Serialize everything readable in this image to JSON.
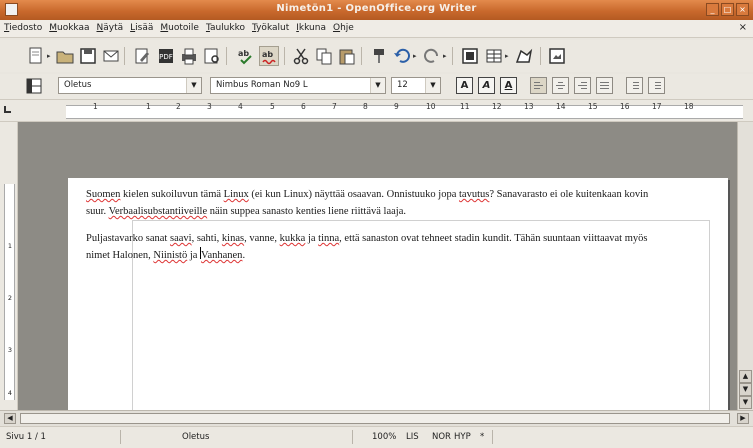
{
  "window": {
    "title": "Nimetön1 - OpenOffice.org Writer",
    "controls": [
      "_",
      "□",
      "×"
    ]
  },
  "menubar": {
    "items": [
      "Tiedosto",
      "Muokkaa",
      "Näytä",
      "Lisää",
      "Muotoile",
      "Taulukko",
      "Työkalut",
      "Ikkuna",
      "Ohje"
    ],
    "close_label": "×"
  },
  "toolbar_standard": {
    "icons": [
      "new-document-icon",
      "open-folder-icon",
      "save-icon",
      "email-icon",
      "edit-file-icon",
      "export-pdf-icon",
      "print-icon",
      "page-preview-icon",
      "spellcheck-icon",
      "auto-spellcheck-icon",
      "cut-icon",
      "copy-icon",
      "paste-icon",
      "format-paintbrush-icon",
      "undo-icon",
      "redo-icon",
      "navigator-icon",
      "table-icon",
      "draw-functions-icon",
      "gallery-icon"
    ]
  },
  "toolbar_formatting": {
    "paragraph_style": "Oletus",
    "font_name": "Nimbus Roman No9 L",
    "font_size": "12",
    "bold": "A",
    "italic": "A",
    "underline": "A"
  },
  "ruler": {
    "labels": [
      "1",
      "1",
      "2",
      "3",
      "4",
      "5",
      "6",
      "7",
      "8",
      "9",
      "10",
      "11",
      "12",
      "13",
      "14",
      "15",
      "16",
      "17",
      "18"
    ],
    "vertical_labels": [
      "1",
      "2",
      "3",
      "4"
    ]
  },
  "document": {
    "paragraph1": {
      "t1": "Suomen",
      "t2": " kielen sukoiluvun tämä ",
      "t3": "Linux",
      "t4": " (ei kun Linux) näyttää osaavan. Onnistuuko jopa ",
      "t5": "tavutus",
      "t6": "? Sanavarasto ei ole kuitenkaan kovin suur. ",
      "t7": "Verbaalisubstantiiveille",
      "t8": " näin suppea sanasto kenties liene riittävä laaja."
    },
    "paragraph2": {
      "t1": "Puljastavarko sanat ",
      "t2": "saavi",
      "t3": ", sahti, ",
      "t4": "kinas",
      "t5": ", vanne, ",
      "t6": "kukka",
      "t7": " ja ",
      "t8": "tinna",
      "t9": ", että  sanaston ovat tehneet stadin kundit. Tähän suuntaan viittaavat myös nimet Halonen, ",
      "t10": "Niinistö",
      "t11": " ja ",
      "t12": "Vanhanen",
      "t13": "."
    }
  },
  "statusbar": {
    "page": "Sivu 1 / 1",
    "style": "Oletus",
    "zoom": "100%",
    "insert_mode": "LIS",
    "selection_mode": "NOR",
    "hyperlink_mode": "HYP",
    "modified": "*"
  }
}
